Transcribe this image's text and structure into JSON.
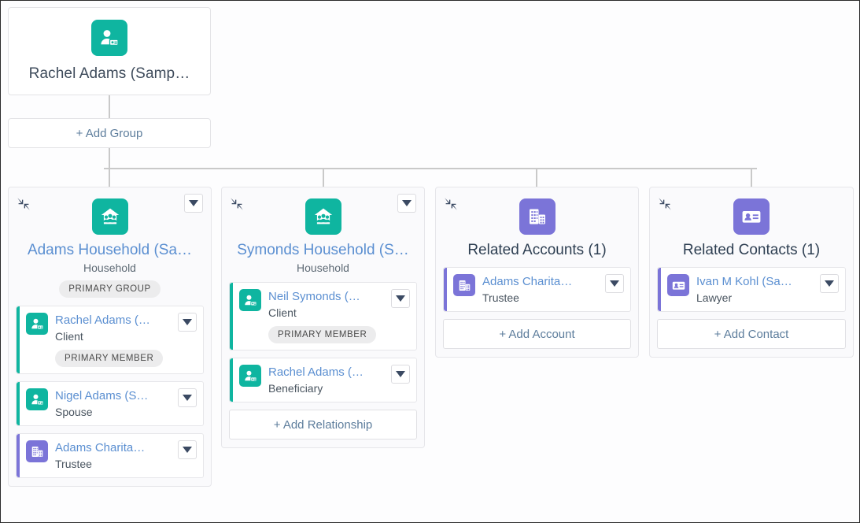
{
  "root": {
    "name": "Rachel Adams (Samp…",
    "icon": "person-account-icon"
  },
  "add_group": {
    "label": "+ Add Group"
  },
  "colors": {
    "teal": "#0fb5a0",
    "purple": "#7b74d8",
    "link": "#5b8fd1",
    "action_link": "#5d7d9c",
    "connector": "#c9c9c9",
    "card_bg": "#fafafc"
  },
  "cards": [
    {
      "id": "adams-household",
      "icon": "household-icon",
      "icon_color": "teal",
      "title": "Adams Household (Sa…",
      "title_link": true,
      "subtitle": "Household",
      "badge": "PRIMARY GROUP",
      "collapse_icon": "collapse-icon",
      "menu_icon": "chevron-down-icon",
      "rows": [
        {
          "icon": "person-account-icon",
          "accent": "teal",
          "name": "Rachel Adams (…",
          "role": "Client",
          "badge": "PRIMARY MEMBER",
          "menu_icon": "chevron-down-icon"
        },
        {
          "icon": "person-account-icon",
          "accent": "teal",
          "name": "Nigel Adams (S…",
          "role": "Spouse",
          "badge": null,
          "menu_icon": "chevron-down-icon"
        },
        {
          "icon": "account-icon",
          "accent": "purple",
          "name": "Adams Charita…",
          "role": "Trustee",
          "badge": null,
          "menu_icon": "chevron-down-icon"
        }
      ],
      "add_label": null
    },
    {
      "id": "symonds-household",
      "icon": "household-icon",
      "icon_color": "teal",
      "title": "Symonds Household (S…",
      "title_link": true,
      "subtitle": "Household",
      "badge": null,
      "collapse_icon": "collapse-icon",
      "menu_icon": "chevron-down-icon",
      "rows": [
        {
          "icon": "person-account-icon",
          "accent": "teal",
          "name": "Neil Symonds (…",
          "role": "Client",
          "badge": "PRIMARY MEMBER",
          "menu_icon": "chevron-down-icon"
        },
        {
          "icon": "person-account-icon",
          "accent": "teal",
          "name": "Rachel Adams (…",
          "role": "Beneficiary",
          "badge": null,
          "menu_icon": "chevron-down-icon"
        }
      ],
      "add_label": "+ Add Relationship"
    },
    {
      "id": "related-accounts",
      "icon": "account-icon",
      "icon_color": "purple",
      "title": "Related Accounts (1)",
      "title_link": false,
      "subtitle": null,
      "badge": null,
      "collapse_icon": "collapse-icon",
      "menu_icon": null,
      "rows": [
        {
          "icon": "account-icon",
          "accent": "purple",
          "name": "Adams Charita…",
          "role": "Trustee",
          "badge": null,
          "menu_icon": "chevron-down-icon"
        }
      ],
      "add_label": "+ Add Account"
    },
    {
      "id": "related-contacts",
      "icon": "contact-icon",
      "icon_color": "purple",
      "title": "Related Contacts (1)",
      "title_link": false,
      "subtitle": null,
      "badge": null,
      "collapse_icon": "collapse-icon",
      "menu_icon": null,
      "rows": [
        {
          "icon": "contact-icon",
          "accent": "purple",
          "name": "Ivan M Kohl (Sa…",
          "role": "Lawyer",
          "badge": null,
          "menu_icon": "chevron-down-icon"
        }
      ],
      "add_label": "+ Add Contact"
    }
  ]
}
